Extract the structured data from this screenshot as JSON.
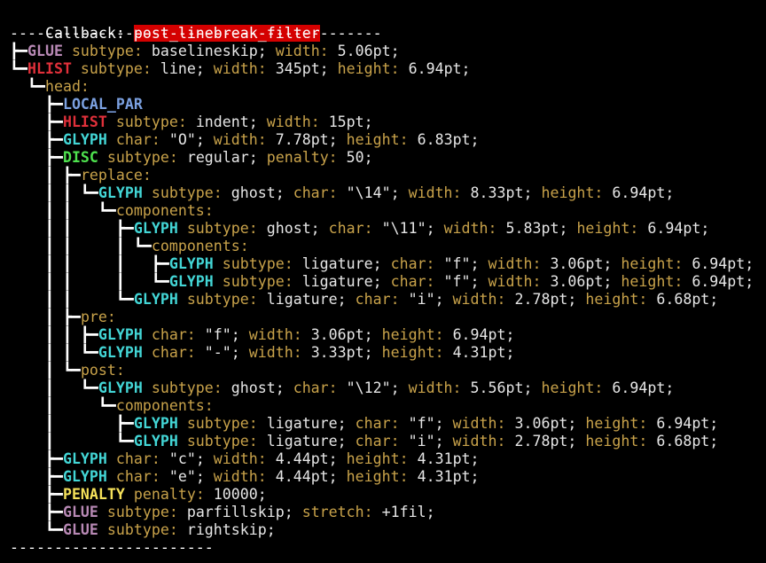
{
  "header": {
    "label": "Callback: ",
    "name": "post_linebreak_filter"
  },
  "rule_top": "------------------------------------------",
  "rule_bottom": "-----------------------",
  "lines": [
    [
      [
        "tree",
        "┣━"
      ],
      [
        "glue",
        "GLUE"
      ],
      [
        "key",
        " subtype: "
      ],
      [
        "val",
        "baselineskip; "
      ],
      [
        "key",
        "width: "
      ],
      [
        "val",
        "5.06pt;"
      ]
    ],
    [
      [
        "tree",
        "┗━"
      ],
      [
        "hlist",
        "HLIST"
      ],
      [
        "key",
        " subtype: "
      ],
      [
        "val",
        "line; "
      ],
      [
        "key",
        "width: "
      ],
      [
        "val",
        "345pt; "
      ],
      [
        "key",
        "height: "
      ],
      [
        "val",
        "6.94pt;"
      ]
    ],
    [
      [
        "tree",
        "  ┗━"
      ],
      [
        "key",
        "head:"
      ]
    ],
    [
      [
        "tree",
        "    ┣━"
      ],
      [
        "local",
        "LOCAL_PAR"
      ]
    ],
    [
      [
        "tree",
        "    ┣━"
      ],
      [
        "hlist",
        "HLIST"
      ],
      [
        "key",
        " subtype: "
      ],
      [
        "val",
        "indent; "
      ],
      [
        "key",
        "width: "
      ],
      [
        "val",
        "15pt;"
      ]
    ],
    [
      [
        "tree",
        "    ┣━"
      ],
      [
        "glyph",
        "GLYPH"
      ],
      [
        "key",
        " char: "
      ],
      [
        "val",
        "\"O\"; "
      ],
      [
        "key",
        "width: "
      ],
      [
        "val",
        "7.78pt; "
      ],
      [
        "key",
        "height: "
      ],
      [
        "val",
        "6.83pt;"
      ]
    ],
    [
      [
        "tree",
        "    ┣━"
      ],
      [
        "disc",
        "DISC"
      ],
      [
        "key",
        " subtype: "
      ],
      [
        "val",
        "regular; "
      ],
      [
        "key",
        "penalty: "
      ],
      [
        "val",
        "50;"
      ]
    ],
    [
      [
        "tree",
        "    ┃ ┣━"
      ],
      [
        "key",
        "replace:"
      ]
    ],
    [
      [
        "tree",
        "    ┃ ┃ ┗━"
      ],
      [
        "glyph",
        "GLYPH"
      ],
      [
        "key",
        " subtype: "
      ],
      [
        "val",
        "ghost; "
      ],
      [
        "key",
        "char: "
      ],
      [
        "val",
        "\"\\14\"; "
      ],
      [
        "key",
        "width: "
      ],
      [
        "val",
        "8.33pt; "
      ],
      [
        "key",
        "height: "
      ],
      [
        "val",
        "6.94pt;"
      ]
    ],
    [
      [
        "tree",
        "    ┃ ┃   ┗━"
      ],
      [
        "key",
        "components:"
      ]
    ],
    [
      [
        "tree",
        "    ┃ ┃     ┣━"
      ],
      [
        "glyph",
        "GLYPH"
      ],
      [
        "key",
        " subtype: "
      ],
      [
        "val",
        "ghost; "
      ],
      [
        "key",
        "char: "
      ],
      [
        "val",
        "\"\\11\"; "
      ],
      [
        "key",
        "width: "
      ],
      [
        "val",
        "5.83pt; "
      ],
      [
        "key",
        "height: "
      ],
      [
        "val",
        "6.94pt;"
      ]
    ],
    [
      [
        "tree",
        "    ┃ ┃     ┃ ┗━"
      ],
      [
        "key",
        "components:"
      ]
    ],
    [
      [
        "tree",
        "    ┃ ┃     ┃   ┣━"
      ],
      [
        "glyph",
        "GLYPH"
      ],
      [
        "key",
        " subtype: "
      ],
      [
        "val",
        "ligature; "
      ],
      [
        "key",
        "char: "
      ],
      [
        "val",
        "\"f\"; "
      ],
      [
        "key",
        "width: "
      ],
      [
        "val",
        "3.06pt; "
      ],
      [
        "key",
        "height: "
      ],
      [
        "val",
        "6.94pt;"
      ]
    ],
    [
      [
        "tree",
        "    ┃ ┃     ┃   ┗━"
      ],
      [
        "glyph",
        "GLYPH"
      ],
      [
        "key",
        " subtype: "
      ],
      [
        "val",
        "ligature; "
      ],
      [
        "key",
        "char: "
      ],
      [
        "val",
        "\"f\"; "
      ],
      [
        "key",
        "width: "
      ],
      [
        "val",
        "3.06pt; "
      ],
      [
        "key",
        "height: "
      ],
      [
        "val",
        "6.94pt;"
      ]
    ],
    [
      [
        "tree",
        "    ┃ ┃     ┗━"
      ],
      [
        "glyph",
        "GLYPH"
      ],
      [
        "key",
        " subtype: "
      ],
      [
        "val",
        "ligature; "
      ],
      [
        "key",
        "char: "
      ],
      [
        "val",
        "\"i\"; "
      ],
      [
        "key",
        "width: "
      ],
      [
        "val",
        "2.78pt; "
      ],
      [
        "key",
        "height: "
      ],
      [
        "val",
        "6.68pt;"
      ]
    ],
    [
      [
        "tree",
        "    ┃ ┣━"
      ],
      [
        "key",
        "pre:"
      ]
    ],
    [
      [
        "tree",
        "    ┃ ┃ ┣━"
      ],
      [
        "glyph",
        "GLYPH"
      ],
      [
        "key",
        " char: "
      ],
      [
        "val",
        "\"f\"; "
      ],
      [
        "key",
        "width: "
      ],
      [
        "val",
        "3.06pt; "
      ],
      [
        "key",
        "height: "
      ],
      [
        "val",
        "6.94pt;"
      ]
    ],
    [
      [
        "tree",
        "    ┃ ┃ ┗━"
      ],
      [
        "glyph",
        "GLYPH"
      ],
      [
        "key",
        " char: "
      ],
      [
        "val",
        "\"-\"; "
      ],
      [
        "key",
        "width: "
      ],
      [
        "val",
        "3.33pt; "
      ],
      [
        "key",
        "height: "
      ],
      [
        "val",
        "4.31pt;"
      ]
    ],
    [
      [
        "tree",
        "    ┃ ┗━"
      ],
      [
        "key",
        "post:"
      ]
    ],
    [
      [
        "tree",
        "    ┃   ┗━"
      ],
      [
        "glyph",
        "GLYPH"
      ],
      [
        "key",
        " subtype: "
      ],
      [
        "val",
        "ghost; "
      ],
      [
        "key",
        "char: "
      ],
      [
        "val",
        "\"\\12\"; "
      ],
      [
        "key",
        "width: "
      ],
      [
        "val",
        "5.56pt; "
      ],
      [
        "key",
        "height: "
      ],
      [
        "val",
        "6.94pt;"
      ]
    ],
    [
      [
        "tree",
        "    ┃     ┗━"
      ],
      [
        "key",
        "components:"
      ]
    ],
    [
      [
        "tree",
        "    ┃       ┣━"
      ],
      [
        "glyph",
        "GLYPH"
      ],
      [
        "key",
        " subtype: "
      ],
      [
        "val",
        "ligature; "
      ],
      [
        "key",
        "char: "
      ],
      [
        "val",
        "\"f\"; "
      ],
      [
        "key",
        "width: "
      ],
      [
        "val",
        "3.06pt; "
      ],
      [
        "key",
        "height: "
      ],
      [
        "val",
        "6.94pt;"
      ]
    ],
    [
      [
        "tree",
        "    ┃       ┗━"
      ],
      [
        "glyph",
        "GLYPH"
      ],
      [
        "key",
        " subtype: "
      ],
      [
        "val",
        "ligature; "
      ],
      [
        "key",
        "char: "
      ],
      [
        "val",
        "\"i\"; "
      ],
      [
        "key",
        "width: "
      ],
      [
        "val",
        "2.78pt; "
      ],
      [
        "key",
        "height: "
      ],
      [
        "val",
        "6.68pt;"
      ]
    ],
    [
      [
        "tree",
        "    ┣━"
      ],
      [
        "glyph",
        "GLYPH"
      ],
      [
        "key",
        " char: "
      ],
      [
        "val",
        "\"c\"; "
      ],
      [
        "key",
        "width: "
      ],
      [
        "val",
        "4.44pt; "
      ],
      [
        "key",
        "height: "
      ],
      [
        "val",
        "4.31pt;"
      ]
    ],
    [
      [
        "tree",
        "    ┣━"
      ],
      [
        "glyph",
        "GLYPH"
      ],
      [
        "key",
        " char: "
      ],
      [
        "val",
        "\"e\"; "
      ],
      [
        "key",
        "width: "
      ],
      [
        "val",
        "4.44pt; "
      ],
      [
        "key",
        "height: "
      ],
      [
        "val",
        "4.31pt;"
      ]
    ],
    [
      [
        "tree",
        "    ┣━"
      ],
      [
        "penalty",
        "PENALTY"
      ],
      [
        "key",
        " penalty: "
      ],
      [
        "val",
        "10000;"
      ]
    ],
    [
      [
        "tree",
        "    ┣━"
      ],
      [
        "glue",
        "GLUE"
      ],
      [
        "key",
        " subtype: "
      ],
      [
        "val",
        "parfillskip; "
      ],
      [
        "key",
        "stretch: "
      ],
      [
        "val",
        "+1fil;"
      ]
    ],
    [
      [
        "tree",
        "    ┗━"
      ],
      [
        "glue",
        "GLUE"
      ],
      [
        "key",
        " subtype: "
      ],
      [
        "val",
        "rightskip;"
      ]
    ]
  ],
  "colors": {
    "background": "#000000",
    "key": "#c8a24a",
    "glue": "#b889b5",
    "hlist": "#e0303a",
    "glyph": "#43d6d6",
    "disc": "#4ee24e",
    "local_par": "#7ba0e0",
    "penalty": "#f5e15a",
    "highlight": "#d40000"
  }
}
